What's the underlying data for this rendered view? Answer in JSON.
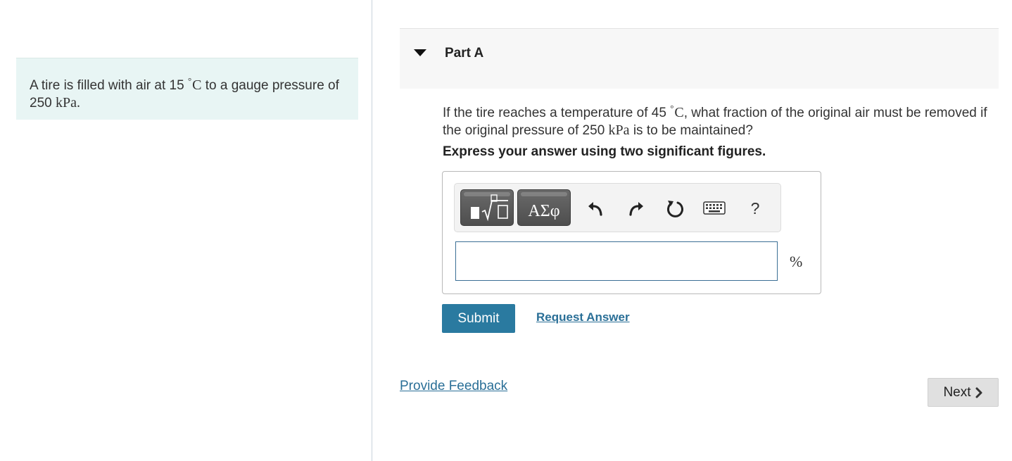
{
  "problem": {
    "text_before": "A tire is filled with air at 15 ",
    "temp_degree": "°",
    "temp_unit": "C",
    "text_middle": " to a gauge pressure of 250 ",
    "pressure_unit": "kPa",
    "text_end": "."
  },
  "part": {
    "title": "Part A",
    "caret_icon": "triangle-down"
  },
  "question": {
    "text_before": "If the tire reaches a temperature of 45 ",
    "temp_degree": "°",
    "temp_unit": "C",
    "text_middle": ", what fraction of the original air must be removed if the original pressure of 250 ",
    "pressure_unit": "kPa",
    "text_end": " is to be maintained?"
  },
  "instruction": "Express your answer using two significant figures.",
  "toolbar": {
    "greek_label": "ΑΣφ",
    "help_label": "?",
    "icons": [
      "templates-icon",
      "greek-letters-button",
      "undo-icon",
      "redo-icon",
      "reset-icon",
      "keyboard-icon",
      "help-icon"
    ]
  },
  "answer": {
    "value": "",
    "unit": "%"
  },
  "buttons": {
    "submit": "Submit",
    "request_answer": "Request Answer",
    "provide_feedback": "Provide Feedback",
    "next": "Next"
  },
  "colors": {
    "problem_bg": "#e8f5f4",
    "submit_bg": "#2a7aa0",
    "link": "#2a6f97",
    "next_bg": "#e0e0e0"
  }
}
